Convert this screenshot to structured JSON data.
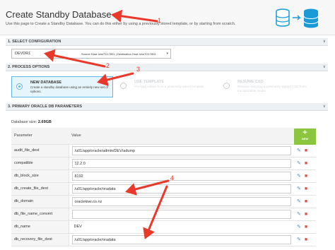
{
  "header": {
    "title": "Create Standby Database",
    "description": "Use this page to Create a Standby Database. You can do this either by using a previously stored template, or by starting from scratch."
  },
  "sections": {
    "select_configuration": "1. SELECT CONFIGURATION",
    "process_options": "2. PROCESS OPTIONS",
    "primary_params": "3. PRIMARY ORACLE DB PARAMETERS"
  },
  "configuration": {
    "selected": "DEVDR1",
    "hosts": "Source Host: kiwi703:7891 | Destination Host: kiwi703:7891"
  },
  "process_options": [
    {
      "title": "NEW DATABASE",
      "desc": "Create a standby database using an entirely new set of options.",
      "selected": true
    },
    {
      "title": "USE TEMPLATE",
      "desc": "Pre-load values from a previously saved template.",
      "selected": false
    },
    {
      "title": "RESUME CSD",
      "desc": "Resume restoring a previously started CSD from transportable media",
      "selected": false
    }
  ],
  "db_size": {
    "label": "Database size:",
    "value": "2.69GB"
  },
  "table": {
    "headers": [
      "Parameter",
      "Value"
    ],
    "new_button": "NEW",
    "rows": [
      {
        "name": "audit_file_dest",
        "value": "/u01/app/oracle/admin/DEV/adump",
        "editable": true
      },
      {
        "name": "compatible",
        "value": "12.2.0",
        "editable": true
      },
      {
        "name": "db_block_size",
        "value": "8192",
        "editable": true
      },
      {
        "name": "db_create_file_dest",
        "value": "/u01/app/oracle/oradata",
        "editable": true
      },
      {
        "name": "db_domain",
        "value": "oraclekiwi.co.nz",
        "editable": true
      },
      {
        "name": "db_file_name_convert",
        "value": "",
        "editable": true
      },
      {
        "name": "db_name",
        "value": "DEV",
        "editable": false
      },
      {
        "name": "db_recovery_file_dest",
        "value": "/u01/app/oracle/oradata",
        "editable": true
      }
    ]
  },
  "annotations": [
    "1",
    "2",
    "3",
    "4"
  ],
  "colors": {
    "accent": "#5bb7e0",
    "new_button": "#8cc63f",
    "annotation": "#e8392b",
    "delete": "#d9534f",
    "edit": "#3b8fd0"
  }
}
